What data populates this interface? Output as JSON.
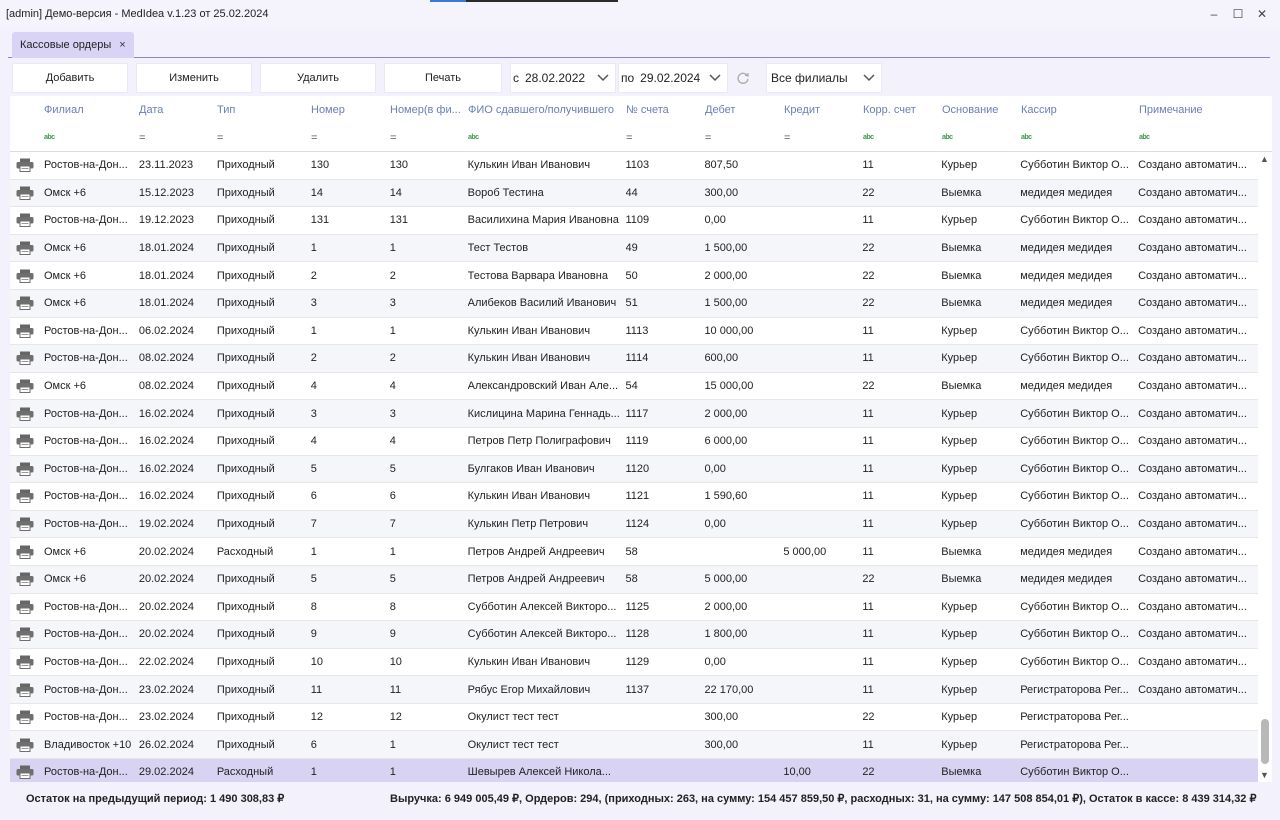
{
  "window": {
    "title": "[admin] Демо-версия  - MedIdea v.1.23 от 25.02.2024",
    "controls": {
      "minimize": "–",
      "maximize": "☐",
      "close": "✕"
    }
  },
  "tabs": [
    {
      "label": "Кассовые ордеры",
      "close": "×",
      "active": true
    }
  ],
  "toolbar": {
    "add_label": "Добавить",
    "edit_label": "Изменить",
    "delete_label": "Удалить",
    "print_label": "Печать",
    "from_label": "с",
    "from_date": "28.02.2022",
    "to_label": "по",
    "to_date": "29.02.2024",
    "branch_select": "Все филиалы"
  },
  "columns": [
    "Филиал",
    "Дата",
    "Тип",
    "Номер",
    "Номер(в фи...",
    "ФИО сдавшего/получившего",
    "№ счета",
    "Дебет",
    "Кредит",
    "Корр. счет",
    "Основание",
    "Кассир",
    "Примечание"
  ],
  "filters": [
    "abc",
    "=",
    "=",
    "=",
    "=",
    "abc",
    "=",
    "=",
    "=",
    "abc",
    "abc",
    "abc",
    "abc"
  ],
  "rows": [
    [
      "Ростов-на-Дон...",
      "23.11.2023",
      "Приходный",
      "130",
      "130",
      "Кулькин Иван Иванович",
      "1103",
      "807,50",
      "",
      "11",
      "Курьер",
      "Субботин Виктор О...",
      "Создано автоматич..."
    ],
    [
      "Омск +6",
      "15.12.2023",
      "Приходный",
      "14",
      "14",
      "Вороб Тестина",
      "44",
      "300,00",
      "",
      "22",
      "Выемка",
      "медидея медидея",
      "Создано автоматич..."
    ],
    [
      "Ростов-на-Дон...",
      "19.12.2023",
      "Приходный",
      "131",
      "131",
      "Василихина Мария Ивановна",
      "1109",
      "0,00",
      "",
      "11",
      "Курьер",
      "Субботин Виктор О...",
      "Создано автоматич..."
    ],
    [
      "Омск +6",
      "18.01.2024",
      "Приходный",
      "1",
      "1",
      "Тест Тестов",
      "49",
      "1 500,00",
      "",
      "22",
      "Выемка",
      "медидея медидея",
      "Создано автоматич..."
    ],
    [
      "Омск +6",
      "18.01.2024",
      "Приходный",
      "2",
      "2",
      "Тестова Варвара Ивановна",
      "50",
      "2 000,00",
      "",
      "22",
      "Выемка",
      "медидея медидея",
      "Создано автоматич..."
    ],
    [
      "Омск +6",
      "18.01.2024",
      "Приходный",
      "3",
      "3",
      "Алибеков Василий Иванович",
      "51",
      "1 500,00",
      "",
      "22",
      "Выемка",
      "медидея медидея",
      "Создано автоматич..."
    ],
    [
      "Ростов-на-Дон...",
      "06.02.2024",
      "Приходный",
      "1",
      "1",
      "Кулькин Иван Иванович",
      "1113",
      "10 000,00",
      "",
      "11",
      "Курьер",
      "Субботин Виктор О...",
      "Создано автоматич..."
    ],
    [
      "Ростов-на-Дон...",
      "08.02.2024",
      "Приходный",
      "2",
      "2",
      "Кулькин Иван Иванович",
      "1114",
      "600,00",
      "",
      "11",
      "Курьер",
      "Субботин Виктор О...",
      "Создано автоматич..."
    ],
    [
      "Омск +6",
      "08.02.2024",
      "Приходный",
      "4",
      "4",
      "Александровский Иван Але...",
      "54",
      "15 000,00",
      "",
      "22",
      "Выемка",
      "медидея медидея",
      "Создано автоматич..."
    ],
    [
      "Ростов-на-Дон...",
      "16.02.2024",
      "Приходный",
      "3",
      "3",
      "Кислицина Марина Геннадь...",
      "1117",
      "2 000,00",
      "",
      "11",
      "Курьер",
      "Субботин Виктор О...",
      "Создано автоматич..."
    ],
    [
      "Ростов-на-Дон...",
      "16.02.2024",
      "Приходный",
      "4",
      "4",
      "Петров Петр Полиграфович",
      "1119",
      "6 000,00",
      "",
      "11",
      "Курьер",
      "Субботин Виктор О...",
      "Создано автоматич..."
    ],
    [
      "Ростов-на-Дон...",
      "16.02.2024",
      "Приходный",
      "5",
      "5",
      "Булгаков Иван Иванович",
      "1120",
      "0,00",
      "",
      "11",
      "Курьер",
      "Субботин Виктор О...",
      "Создано автоматич..."
    ],
    [
      "Ростов-на-Дон...",
      "16.02.2024",
      "Приходный",
      "6",
      "6",
      "Кулькин Иван Иванович",
      "1121",
      "1 590,60",
      "",
      "11",
      "Курьер",
      "Субботин Виктор О...",
      "Создано автоматич..."
    ],
    [
      "Ростов-на-Дон...",
      "19.02.2024",
      "Приходный",
      "7",
      "7",
      "Кулькин Петр Петрович",
      "1124",
      "0,00",
      "",
      "11",
      "Курьер",
      "Субботин Виктор О...",
      "Создано автоматич..."
    ],
    [
      "Омск +6",
      "20.02.2024",
      "Расходный",
      "1",
      "1",
      "Петров Андрей Андреевич",
      "58",
      "",
      "5 000,00",
      "11",
      "Выемка",
      "медидея медидея",
      "Создано автоматич..."
    ],
    [
      "Омск +6",
      "20.02.2024",
      "Приходный",
      "5",
      "5",
      "Петров Андрей Андреевич",
      "58",
      "5 000,00",
      "",
      "22",
      "Выемка",
      "медидея медидея",
      "Создано автоматич..."
    ],
    [
      "Ростов-на-Дон...",
      "20.02.2024",
      "Приходный",
      "8",
      "8",
      "Субботин Алексей Викторо...",
      "1125",
      "2 000,00",
      "",
      "11",
      "Курьер",
      "Субботин Виктор О...",
      "Создано автоматич..."
    ],
    [
      "Ростов-на-Дон...",
      "20.02.2024",
      "Приходный",
      "9",
      "9",
      "Субботин Алексей Викторо...",
      "1128",
      "1 800,00",
      "",
      "11",
      "Курьер",
      "Субботин Виктор О...",
      "Создано автоматич..."
    ],
    [
      "Ростов-на-Дон...",
      "22.02.2024",
      "Приходный",
      "10",
      "10",
      "Кулькин Иван Иванович",
      "1129",
      "0,00",
      "",
      "11",
      "Курьер",
      "Субботин Виктор О...",
      "Создано автоматич..."
    ],
    [
      "Ростов-на-Дон...",
      "23.02.2024",
      "Приходный",
      "11",
      "11",
      "Рябус Егор Михайлович",
      "1137",
      "22 170,00",
      "",
      "11",
      "Курьер",
      "Регистраторова Рег...",
      "Создано автоматич..."
    ],
    [
      "Ростов-на-Дон...",
      "23.02.2024",
      "Приходный",
      "12",
      "12",
      "Окулист тест тест",
      "",
      "300,00",
      "",
      "22",
      "Курьер",
      "Регистраторова Рег...",
      ""
    ],
    [
      "Владивосток +10",
      "26.02.2024",
      "Приходный",
      "6",
      "1",
      "Окулист тест тест",
      "",
      "300,00",
      "",
      "11",
      "Курьер",
      "Регистраторова Рег...",
      ""
    ],
    [
      "Ростов-на-Дон...",
      "29.02.2024",
      "Расходный",
      "1",
      "1",
      "Шевырев  Алексей  Никола...",
      "",
      "",
      "10,00",
      "22",
      "Выемка",
      "Субботин Виктор О...",
      ""
    ]
  ],
  "selected_row": 22,
  "footer": {
    "balance_prev": "Остаток на предыдущий период: 1 490 308,83 ₽",
    "summary": "Выручка: 6 949 005,49 ₽, Ордеров: 294, (приходных: 263, на сумму: 154 457 859,50 ₽, расходных: 31, на сумму: 147 508 854,01 ₽), Остаток в кассе: 8 439 314,32 ₽"
  },
  "colors": {
    "accent": "#8e86c4",
    "selected_row": "#d8d2f3",
    "header_text": "#6b7fb3",
    "tab_bg": "#d9d4f5"
  },
  "icons": {
    "row_action": "printer-icon",
    "refresh": "refresh-icon",
    "dropdown": "chevron-down-icon"
  }
}
